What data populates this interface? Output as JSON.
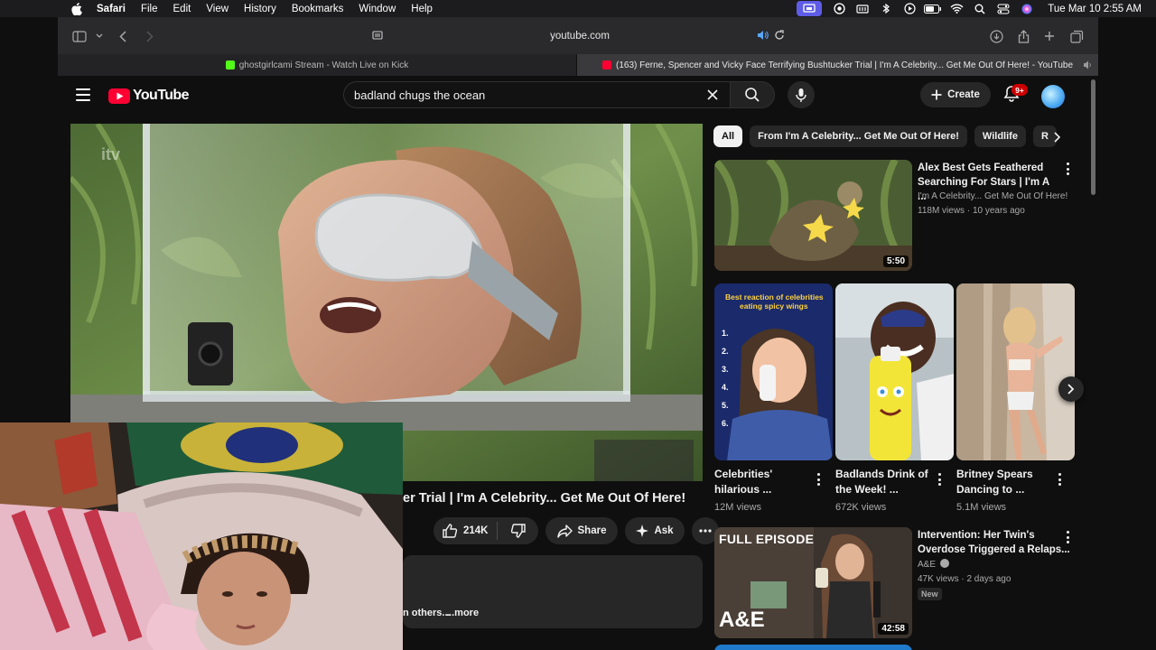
{
  "menubar": {
    "app": "Safari",
    "menus": [
      "File",
      "Edit",
      "View",
      "History",
      "Bookmarks",
      "Window",
      "Help"
    ],
    "clock": "Tue Mar 10  2:55 AM"
  },
  "browser": {
    "url": "youtube.com",
    "tabs": [
      {
        "title": "ghostgirlcami Stream - Watch Live on Kick"
      },
      {
        "title": "(163) Ferne, Spencer and Vicky Face Terrifying Bushtucker Trial | I'm A Celebrity... Get Me Out Of Here! - YouTube"
      }
    ]
  },
  "youtube": {
    "logo_text": "YouTube",
    "search_value": "badland chugs the ocean",
    "create_label": "Create",
    "notification_badge": "9+",
    "video": {
      "title": "er Trial | I'm A Celebrity... Get Me Out Of Here!",
      "likes": "214K",
      "share_label": "Share",
      "ask_label": "Ask",
      "desc_others": "n others...",
      "desc_more": "...more"
    },
    "chips": [
      "All",
      "From I'm A Celebrity... Get Me Out Of Here!",
      "Wildlife",
      "R"
    ],
    "recommendations": [
      {
        "title": "Alex Best Gets Feathered Searching For Stars | I'm A ...",
        "channel": "I'm A Celebrity... Get Me Out Of Here!",
        "meta": "118M views · 10 years ago",
        "duration": "5:50"
      },
      {
        "title": "Intervention: Her Twin's Overdose Triggered a Relaps...",
        "channel": "A&E",
        "meta": "47K views · 2 days ago",
        "badge": "New",
        "duration": "42:58",
        "thumb_label": "FULL EPISODE",
        "thumb_brand": "A&E"
      }
    ],
    "shorts": [
      {
        "title": "Celebrities' hilarious ...",
        "views": "12M views",
        "overlay": "Best reaction of celebrities eating spicy wings",
        "list": [
          "1.",
          "2.",
          "3.",
          "4.",
          "5.",
          "6."
        ]
      },
      {
        "title": "Badlands Drink of the Week! ...",
        "views": "672K views"
      },
      {
        "title": "Britney Spears Dancing to ...",
        "views": "5.1M views"
      }
    ]
  },
  "colors": {
    "yt_red": "#ff0033",
    "bg": "#0f0f0f",
    "chip_bg": "#272727",
    "badge_red": "#cc0000",
    "menubar_active": "#5e5ce6"
  }
}
